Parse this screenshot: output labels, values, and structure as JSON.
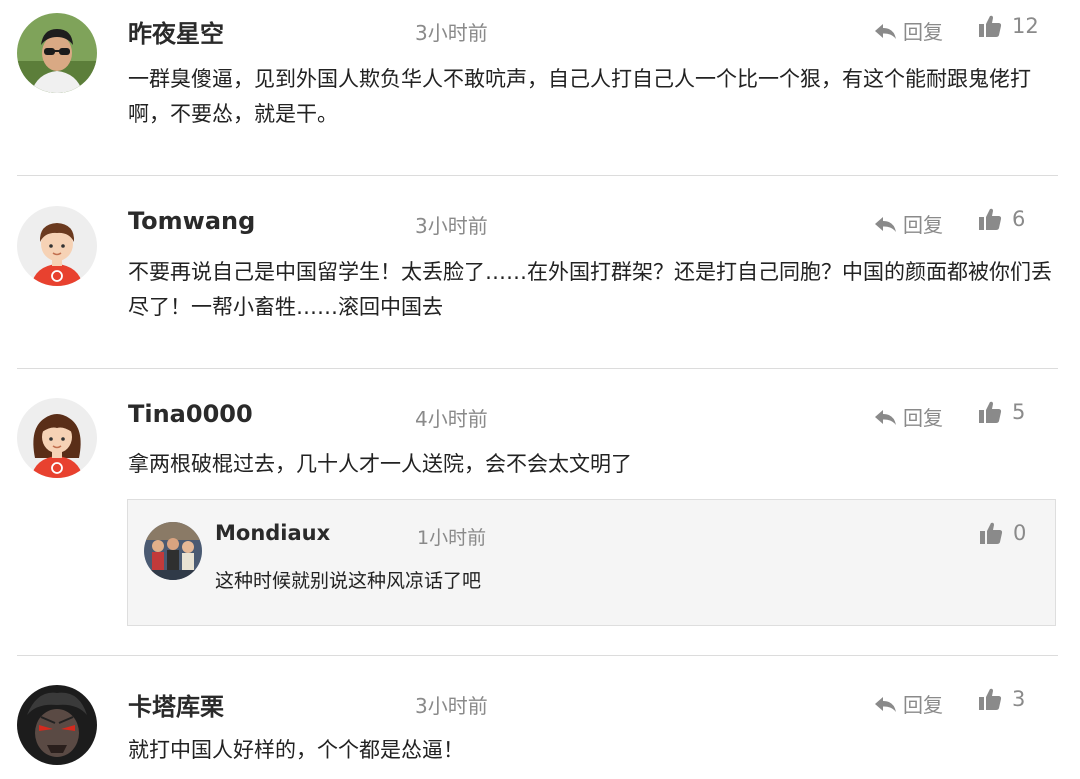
{
  "comments": [
    {
      "username": "昨夜星空",
      "time": "3小时前",
      "reply_label": "回复",
      "likes": "12",
      "text": "一群臭傻逼，见到外国人欺负华人不敢吭声，自己人打自己人一个比一个狠，有这个能耐跟鬼佬打啊，不要怂，就是干。"
    },
    {
      "username": "Tomwang",
      "time": "3小时前",
      "reply_label": "回复",
      "likes": "6",
      "text": "不要再说自己是中国留学生！太丢脸了……在外国打群架？还是打自己同胞？中国的颜面都被你们丢尽了！一帮小畜牲……滚回中国去"
    },
    {
      "username": "Tina0000",
      "time": "4小时前",
      "reply_label": "回复",
      "likes": "5",
      "text": "拿两根破棍过去，几十人才一人送院，会不会太文明了",
      "replies": [
        {
          "username": "Mondiaux",
          "time": "1小时前",
          "likes": "0",
          "text": "这种时候就别说这种风凉话了吧"
        }
      ]
    },
    {
      "username": "卡塔库栗",
      "time": "3小时前",
      "reply_label": "回复",
      "likes": "3",
      "text": "就打中国人好样的，个个都是怂逼！"
    }
  ],
  "colors": {
    "meta_gray": "#8a8a8a",
    "divider": "#dcdcdc",
    "avatar_red": "#e8412f",
    "subreply_bg": "#f5f5f5"
  },
  "icons": {
    "reply": "reply-arrow-icon",
    "like": "thumbs-up-icon"
  }
}
